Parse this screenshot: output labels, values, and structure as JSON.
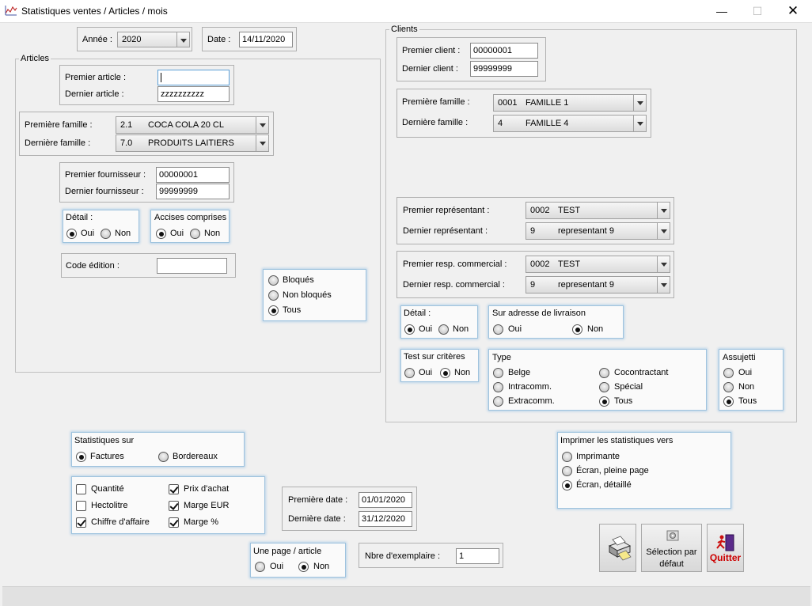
{
  "window": {
    "title": "Statistiques ventes / Articles / mois",
    "minimize_icon": "minimize-icon",
    "maximize_icon": "maximize-icon",
    "close_icon": "close-icon",
    "app_icon": "chart-icon"
  },
  "header": {
    "annee_label": "Année :",
    "annee_value": "2020",
    "date_label": "Date :",
    "date_value": "14/11/2020"
  },
  "articles": {
    "legend": "Articles",
    "premier_article_label": "Premier article :",
    "premier_article_value": "",
    "dernier_article_label": "Dernier article :",
    "dernier_article_value": "zzzzzzzzzz",
    "premiere_famille_label": "Première famille :",
    "premiere_famille_code": "2.1",
    "premiere_famille_name": "COCA COLA 20 CL",
    "derniere_famille_label": "Dernière famille :",
    "derniere_famille_code": "7.0",
    "derniere_famille_name": "PRODUITS LAITIERS",
    "premier_fournisseur_label": "Premier fournisseur :",
    "premier_fournisseur_value": "00000001",
    "dernier_fournisseur_label": "Dernier fournisseur :",
    "dernier_fournisseur_value": "99999999",
    "detail_title": "Détail :",
    "detail_oui": "Oui",
    "detail_non": "Non",
    "detail_selected": "Oui",
    "accises_title": "Accises comprises",
    "accises_oui": "Oui",
    "accises_non": "Non",
    "accises_selected": "Oui",
    "code_edition_label": "Code édition :",
    "code_edition_value": "",
    "blocage_options": [
      "Bloqués",
      "Non bloqués",
      "Tous"
    ],
    "blocage_selected": "Tous"
  },
  "clients": {
    "legend": "Clients",
    "premier_client_label": "Premier client :",
    "premier_client_value": "00000001",
    "dernier_client_label": "Dernier client :",
    "dernier_client_value": "99999999",
    "premiere_famille_label": "Première famille :",
    "premiere_famille_code": "0001",
    "premiere_famille_name": "FAMILLE 1",
    "derniere_famille_label": "Dernière famille :",
    "derniere_famille_code": "4",
    "derniere_famille_name": "FAMILLE 4",
    "premier_rep_label": "Premier représentant :",
    "premier_rep_code": "0002",
    "premier_rep_name": "TEST",
    "dernier_rep_label": "Dernier représentant :",
    "dernier_rep_code": "9",
    "dernier_rep_name": "representant 9",
    "premier_resp_label": "Premier resp. commercial :",
    "premier_resp_code": "0002",
    "premier_resp_name": "TEST",
    "dernier_resp_label": "Dernier resp. commercial :",
    "dernier_resp_code": "9",
    "dernier_resp_name": "representant 9",
    "detail_title": "Détail :",
    "detail_oui": "Oui",
    "detail_non": "Non",
    "detail_selected": "Oui",
    "livraison_title": "Sur adresse de livraison",
    "livraison_oui": "Oui",
    "livraison_non": "Non",
    "livraison_selected": "Non",
    "test_title": "Test sur critères",
    "test_oui": "Oui",
    "test_non": "Non",
    "test_selected": "Non",
    "type_title": "Type",
    "type_options": [
      "Belge",
      "Intracomm.",
      "Extracomm.",
      "Cocontractant",
      "Spécial",
      "Tous"
    ],
    "type_selected": "Tous",
    "assujetti_title": "Assujetti",
    "assujetti_options": [
      "Oui",
      "Non",
      "Tous"
    ],
    "assujetti_selected": "Tous"
  },
  "stats": {
    "title": "Statistiques sur",
    "factures": "Factures",
    "bordereaux": "Bordereaux",
    "selected": "Factures",
    "checks": [
      {
        "label": "Quantité",
        "checked": false
      },
      {
        "label": "Hectolitre",
        "checked": false
      },
      {
        "label": "Chiffre d'affaire",
        "checked": true
      },
      {
        "label": "Prix d'achat",
        "checked": true
      },
      {
        "label": "Marge EUR",
        "checked": true
      },
      {
        "label": "Marge %",
        "checked": true
      }
    ]
  },
  "dates": {
    "premiere_label": "Première date :",
    "premiere_value": "01/01/2020",
    "derniere_label": "Dernière date :",
    "derniere_value": "31/12/2020"
  },
  "une_page": {
    "title": "Une page / article",
    "oui": "Oui",
    "non": "Non",
    "selected": "Non"
  },
  "exemplaires": {
    "label": "Nbre d'exemplaire :",
    "value": "1"
  },
  "imprimer": {
    "title": "Imprimer les statistiques vers",
    "options": [
      "Imprimante",
      "Écran, pleine page",
      "Écran, détaillé"
    ],
    "selected": "Écran, détaillé"
  },
  "buttons": {
    "print_icon": "printer-icon",
    "selection_label_1": "Sélection par",
    "selection_label_2": "défaut",
    "selection_icon": "settings-icon",
    "quitter_label": "Quitter",
    "quitter_icon": "running-man-icon"
  },
  "colors": {
    "panel_border": "#9fc3de",
    "quitter_text": "#cc0000"
  }
}
